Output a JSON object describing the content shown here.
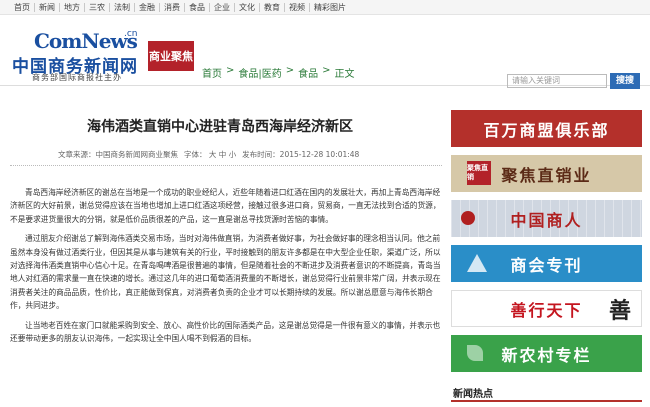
{
  "topnav": [
    "首页",
    "新闻",
    "地方",
    "三农",
    "法制",
    "金融",
    "消费",
    "食品",
    "企业",
    "文化",
    "教育",
    "视频",
    "精彩图片"
  ],
  "logo": {
    "en": "ComNews",
    "cn_dot": ".cn",
    "cn": "中国商务新闻网",
    "sub": "商务部国际商报社主办",
    "badge": "商业聚焦"
  },
  "breadcrumb": [
    "首页",
    ">",
    "食品|医药",
    ">",
    "食品",
    ">",
    "正文"
  ],
  "search": {
    "placeholder": "请输入关键词",
    "button": "搜搜"
  },
  "article": {
    "title": "海伟酒类直销中心进驻青岛西海岸经济新区",
    "source": "文章来源：中国商务新闻网商业聚焦",
    "font_label": "字体：",
    "font_sizes": [
      "大",
      "中",
      "小"
    ],
    "time": "发布时间：2015-12-28 10:01:48",
    "paragraphs": [
      "青岛西海岸经济新区的谢总在当地是一个成功的职业经纪人，近些年随着进口红酒在国内的发展壮大，再加上青岛西海岸经济新区的大好前景，谢总觉得应该在当地也增加上进口红酒这项经营，接触过很多进口商，贸易商，一直无法找到合适的货源，不是要求进货量很大的分销，就是低价品质很差的产品，这一直是谢总寻找货源时苦恼的事情。",
      "通过朋友介绍谢总了解到海伟酒类交易市场，当时对海伟做直销，为消费者做好事，为社会做好事的理念相当认同。他之前虽然本身没有做过酒类行业，但因其是从事与建筑有关的行业，平时接触到的朋友许多都是在中大型企业任职，渠道广泛，所以对选择海伟酒类直销中心信心十足。在青岛喝啤酒是很普遍的事情，但是随着社会的不断进步及消费者意识的不断提高，青岛当地人对红酒的需求量一直在快速的增长。通过这几年的进口葡萄酒消费量的不断增长，谢总觉得行业前景非常广阔，并表示现在消费者关注的商品品质，性价比，真正能做到保真，对消费者负责的企业才可以长期持续的发展。所以谢总愿意与海伟长期合作，共同进步。",
      "让当地老百姓在家门口就能采购到安全、放心、高性价比的国际酒类产品，这是谢总觉得是一件很有意义的事情，并表示也还要带动更多的朋友认识海伟，一起实现让全中国人喝不到假酒的目标。"
    ]
  },
  "sidebar": {
    "banners": [
      {
        "text": "百万商盟俱乐部"
      },
      {
        "text": "聚焦直销业",
        "seal": "聚焦直销"
      },
      {
        "text": "中国商人"
      },
      {
        "text": "商会专刊"
      },
      {
        "text": "善行天下",
        "calli": "善"
      },
      {
        "text": "新农村专栏"
      }
    ],
    "hot_title": "新闻热点"
  }
}
